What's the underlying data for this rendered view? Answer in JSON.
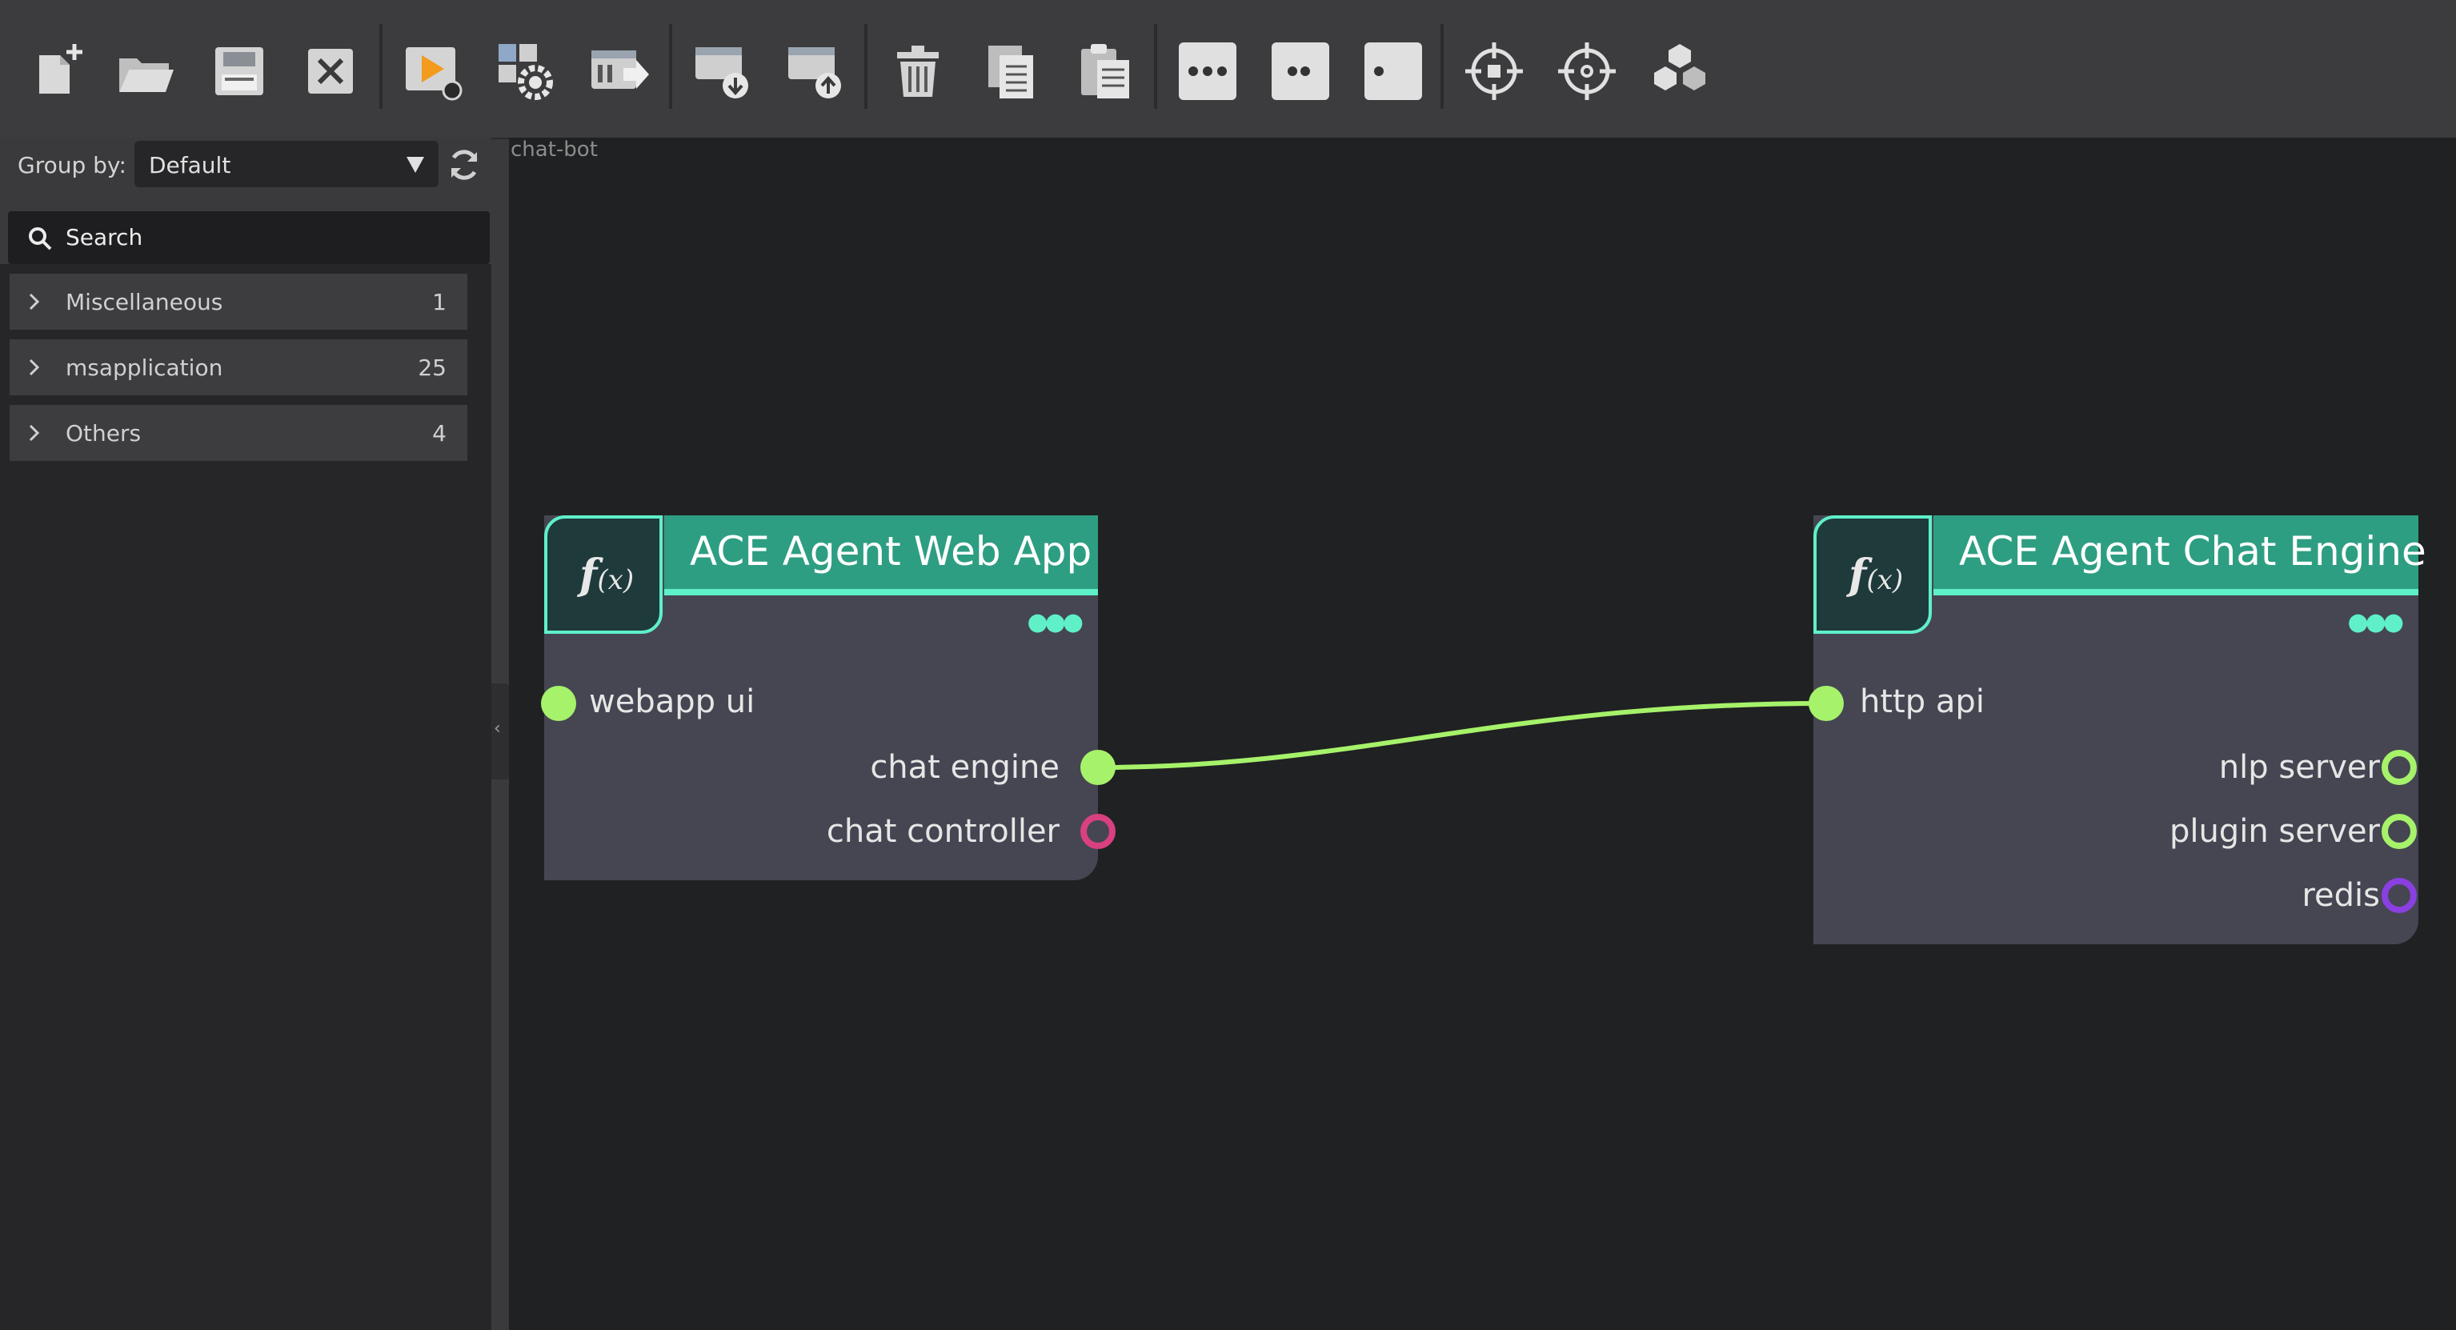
{
  "toolbar": {
    "buttons": [
      {
        "name": "new-file-icon"
      },
      {
        "name": "open-folder-icon"
      },
      {
        "name": "save-icon"
      },
      {
        "name": "close-icon"
      },
      {
        "name": "run-icon"
      },
      {
        "name": "settings-icon"
      },
      {
        "name": "deploy-icon"
      },
      {
        "name": "import-icon"
      },
      {
        "name": "export-icon"
      },
      {
        "name": "trash-icon"
      },
      {
        "name": "copy-icon"
      },
      {
        "name": "paste-icon"
      },
      {
        "name": "three-dots-icon"
      },
      {
        "name": "two-dots-icon"
      },
      {
        "name": "one-dot-icon"
      },
      {
        "name": "crosshair-icon"
      },
      {
        "name": "crosshair-alt-icon"
      },
      {
        "name": "network-icon"
      }
    ]
  },
  "sidebar": {
    "groupby_label": "Group by:",
    "groupby_value": "Default",
    "search_label": "Search",
    "categories": [
      {
        "label": "Miscellaneous",
        "count": "1"
      },
      {
        "label": "msapplication",
        "count": "25"
      },
      {
        "label": "Others",
        "count": "4"
      }
    ]
  },
  "canvas": {
    "title": "chat-bot",
    "nodes": [
      {
        "title": "ACE Agent Web App",
        "fx": "f",
        "fx_sub": "(x)",
        "menu": "●●●",
        "inputs": [
          "webapp ui"
        ],
        "outputs": [
          "chat engine",
          "chat controller"
        ]
      },
      {
        "title": "ACE Agent Chat Engine",
        "fx": "f",
        "fx_sub": "(x)",
        "menu": "●●●",
        "inputs": [
          "http api"
        ],
        "outputs": [
          "nlp server",
          "plugin server",
          "redis"
        ]
      }
    ]
  },
  "colors": {
    "accent": "#5ff0c8",
    "node_header": "#2e9e82",
    "wire": "#a6f26a",
    "port_pink": "#d9407f",
    "port_purple": "#8a3fe0",
    "canvas_bg": "#202122"
  }
}
